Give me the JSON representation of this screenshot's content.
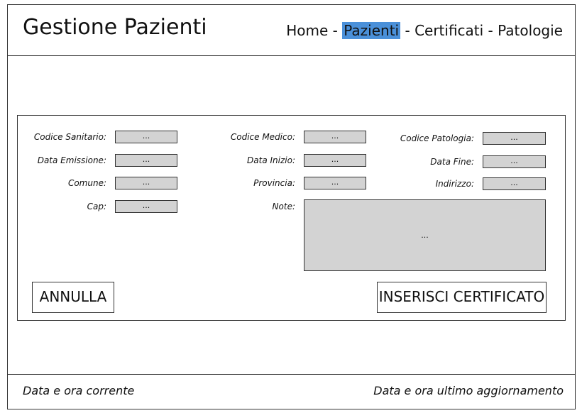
{
  "header": {
    "title": "Gestione Pazienti",
    "nav": [
      {
        "label": "Home"
      },
      {
        "label": "Pazienti"
      },
      {
        "label": "Certificati"
      },
      {
        "label": "Patologie"
      }
    ],
    "separator": " - "
  },
  "form": {
    "codice_sanitario": {
      "label": "Codice Sanitario:",
      "value": "..."
    },
    "data_emissione": {
      "label": "Data Emissione:",
      "value": "..."
    },
    "comune": {
      "label": "Comune:",
      "value": "..."
    },
    "cap": {
      "label": "Cap:",
      "value": "..."
    },
    "codice_medico": {
      "label": "Codice Medico:",
      "value": "..."
    },
    "data_inizio": {
      "label": "Data Inizio:",
      "value": "..."
    },
    "provincia": {
      "label": "Provincia:",
      "value": "..."
    },
    "note": {
      "label": "Note:",
      "value": "..."
    },
    "codice_patologia": {
      "label": "Codice Patologia:",
      "value": "..."
    },
    "data_fine": {
      "label": "Data Fine:",
      "value": "..."
    },
    "indirizzo": {
      "label": "Indirizzo:",
      "value": "..."
    }
  },
  "buttons": {
    "cancel": "ANNULLA",
    "submit": "INSERISCI CERTIFICATO"
  },
  "footer": {
    "left": "Data e ora corrente",
    "right": "Data e ora ultimo aggiornamento"
  },
  "colors": {
    "active_nav": "#4a90d9",
    "field_bg": "#d3d3d3",
    "border": "#333333"
  }
}
